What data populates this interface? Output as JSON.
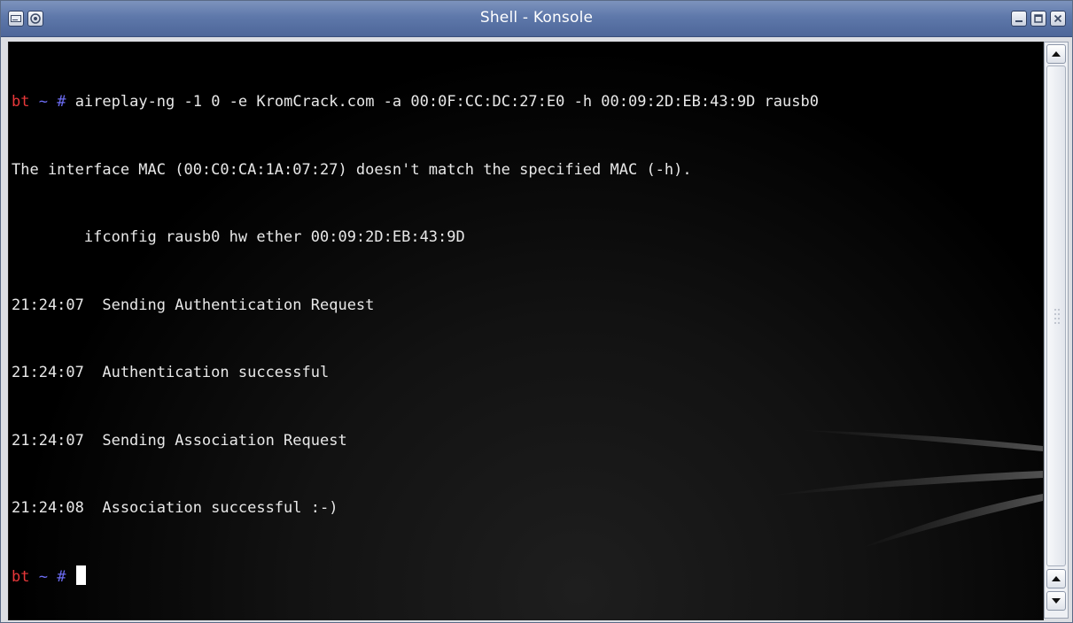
{
  "window": {
    "title": "Shell - Konsole",
    "menu_icon": "window-menu-icon",
    "sticky_icon": "pin-icon",
    "minimize_icon": "minimize-icon",
    "maximize_icon": "maximize-icon",
    "close_icon": "close-icon",
    "accent_color": "#5e78aa"
  },
  "terminal": {
    "prompt": {
      "host": "bt",
      "symbols": " ~ #",
      "host_color": "#e8383a",
      "symbol_color": "#6c6cf2"
    },
    "command": "aireplay-ng -1 0 -e KromCrack.com -a 00:0F:CC:DC:27:E0 -h 00:09:2D:EB:43:9D rausb0",
    "output": [
      "The interface MAC (00:C0:CA:1A:07:27) doesn't match the specified MAC (-h).",
      "        ifconfig rausb0 hw ether 00:09:2D:EB:43:9D",
      "21:24:07  Sending Authentication Request",
      "21:24:07  Authentication successful",
      "21:24:07  Sending Association Request",
      "21:24:08  Association successful :-)"
    ],
    "text_color": "#e8e8e8",
    "background_color": "#000000"
  },
  "scrollbar": {
    "up_icon": "arrow-up-icon",
    "down_icon": "arrow-down-icon"
  }
}
